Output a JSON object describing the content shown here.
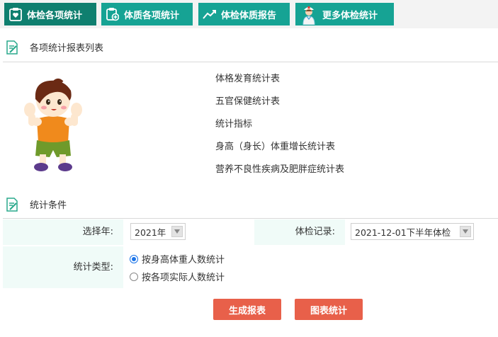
{
  "tabs": [
    {
      "label": "体检各项统计",
      "icon": "clipboard-heart-icon",
      "active": true
    },
    {
      "label": "体质各项统计",
      "icon": "clipboard-plus-icon",
      "active": false
    },
    {
      "label": "体检体质报告",
      "icon": "trend-line-icon",
      "active": false
    },
    {
      "label": "更多体检统计",
      "icon": "nurse-icon",
      "active": false
    }
  ],
  "report_section": {
    "title": "各项统计报表列表",
    "icon": "edit-document-icon",
    "items": [
      "体格发育统计表",
      "五官保健统计表",
      "统计指标",
      "身高（身长）体重增长统计表",
      "营养不良性疾病及肥胖症统计表"
    ]
  },
  "condition_section": {
    "title": "统计条件",
    "icon": "edit-document-icon",
    "year_label": "选择年:",
    "year_value": "2021年",
    "record_label": "体检记录:",
    "record_value": "2021-12-01下半年体检",
    "type_label": "统计类型:",
    "type_options": [
      {
        "label": "按身高体重人数统计",
        "selected": true
      },
      {
        "label": "按各项实际人数统计",
        "selected": false
      }
    ]
  },
  "buttons": {
    "generate": "生成报表",
    "chart": "图表统计"
  },
  "colors": {
    "tab": "#16a394",
    "tab_active": "#0f7f6f",
    "button": "#e8604a",
    "label_bg": "#f0fbf8"
  }
}
